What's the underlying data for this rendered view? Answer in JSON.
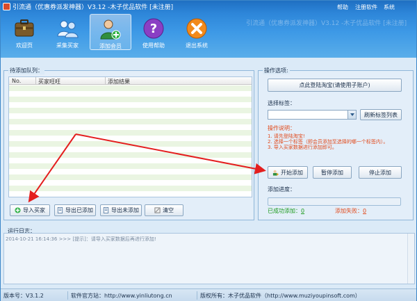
{
  "window": {
    "title": "引流通（优惠券派发神器）V3.12 -木子优品软件 [未注册]",
    "ghost_title": "引流通（优惠券派发神器）V3.12 -木子优品软件 [未注册]",
    "menu": [
      "帮助",
      "注册软件",
      "系统"
    ]
  },
  "toolbar": {
    "items": [
      {
        "label": "欢迎页",
        "icon": "briefcase-icon"
      },
      {
        "label": "采集买家",
        "icon": "people-collect-icon"
      },
      {
        "label": "添加会员",
        "icon": "user-add-icon"
      },
      {
        "label": "使用帮助",
        "icon": "question-icon"
      },
      {
        "label": "退出系统",
        "icon": "exit-x-icon"
      }
    ],
    "active_index": 2
  },
  "queue": {
    "group_title": "待添加队列：",
    "columns": [
      "No.",
      "买家旺旺",
      "添加结果"
    ],
    "rows": [],
    "buttons": {
      "import": "导入买家",
      "export_added": "导出已添加",
      "export_not_added": "导出未添加",
      "clear": "清空"
    }
  },
  "options": {
    "group_title": "操作选项:",
    "login_button": "点此登陆淘宝(请使用子账户)",
    "tag_label": "选择标签：",
    "tag_selected": "",
    "refresh_tags_button": "刷新标签列表",
    "instructions_title": "操作说明：",
    "instructions": [
      "1. 请先登陆淘宝!",
      "2. 选择一个标签（即会员添加至选择的哪一个标签内）。",
      "3. 导入买家数据进行添加即可。"
    ],
    "start_button": "开始添加",
    "pause_button": "暂停添加",
    "stop_button": "停止添加",
    "progress_label": "添加进度：",
    "progress": 0,
    "success_label": "已成功添加：",
    "success_count": "0",
    "fail_label": "添加失败：",
    "fail_count": "0"
  },
  "log": {
    "group_title": "运行日志：",
    "entries": [
      "2014-10-21 16:14:36 >>> [提示]：请导入买家数据后再进行添加!"
    ]
  },
  "statusbar": {
    "version": "版本号：V3.1.2",
    "website": "软件官方站：http://www.yinliutong.cn",
    "copyright": "版权所有：木子优品软件（http://www.muziyoupinsoft.com）"
  },
  "colors": {
    "title_bar": "#1f6fc2",
    "accent_red": "#e2491b",
    "accent_green": "#1c9a1c"
  }
}
